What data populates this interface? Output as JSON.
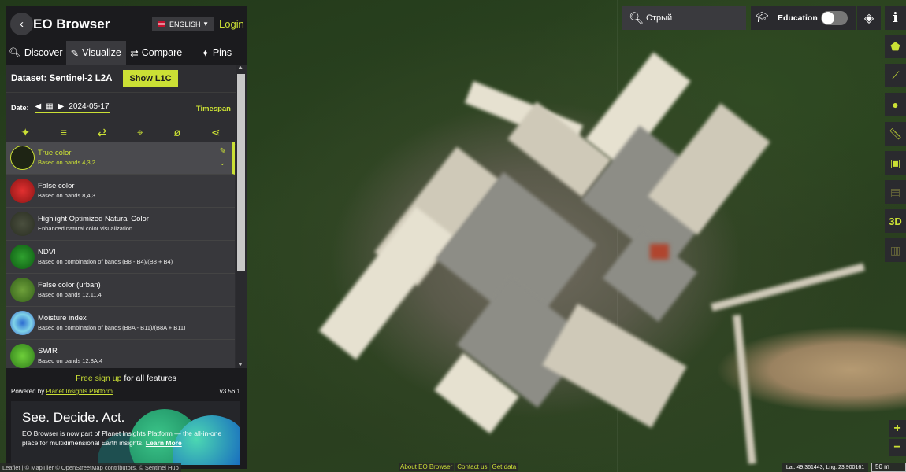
{
  "header": {
    "back_icon": "chevron-left-icon",
    "title": "EO Browser",
    "language": "ENGLISH",
    "login": "Login"
  },
  "tabs": [
    {
      "label": "Discover",
      "icon": "search-icon"
    },
    {
      "label": "Visualize",
      "icon": "brush-icon",
      "active": true
    },
    {
      "label": "Compare",
      "icon": "compare-icon"
    },
    {
      "label": "Pins",
      "icon": "pin-icon"
    }
  ],
  "dataset": {
    "label": "Dataset: Sentinel-2 L2A",
    "show_l1c": "Show L1C"
  },
  "date": {
    "label": "Date:",
    "value": "2024-05-17",
    "timespan": "Timespan"
  },
  "layers": [
    {
      "name": "True color",
      "desc": "Based on bands 4,3,2",
      "active": true
    },
    {
      "name": "False color",
      "desc": "Based on bands 8,4,3"
    },
    {
      "name": "Highlight Optimized Natural Color",
      "desc": "Enhanced natural color visualization"
    },
    {
      "name": "NDVI",
      "desc": "Based on combination of bands (B8 - B4)/(B8 + B4)"
    },
    {
      "name": "False color (urban)",
      "desc": "Based on bands 12,11,4"
    },
    {
      "name": "Moisture index",
      "desc": "Based on combination of bands (B8A - B11)/(B8A + B11)"
    },
    {
      "name": "SWIR",
      "desc": "Based on bands 12,8A,4"
    }
  ],
  "footer": {
    "signup_link": "Free sign up",
    "signup_rest": " for all features",
    "powered_by": "Powered by ",
    "powered_link": "Planet Insights Platform",
    "version": "v3.56.1",
    "promo_title": "See. Decide. Act.",
    "promo_text": "EO Browser is now part of Planet Insights Platform — the all-in-one place for multidimensional Earth insights.",
    "promo_link": "Learn More"
  },
  "search": {
    "value": "Стрый"
  },
  "education": {
    "label": "Education",
    "enabled": false
  },
  "map_tools": [
    "aoi-icon",
    "measure-line-icon",
    "poi-icon",
    "ruler-icon",
    "image-download-icon",
    "timelapse-icon",
    "3d",
    "histogram-icon"
  ],
  "tool_3d_label": "3D",
  "zoom": {
    "in": "+",
    "out": "−"
  },
  "attribution": "Leaflet | © MapTiler © OpenStreetMap contributors, © Sentinel Hub",
  "bottom_links": [
    "About EO Browser",
    "Contact us",
    "Get data"
  ],
  "coords": "Lat: 49.361443, Lng: 23.900161",
  "scale": "50 m",
  "colors": {
    "accent": "#cbe035",
    "panel": "#1b1b1e"
  }
}
